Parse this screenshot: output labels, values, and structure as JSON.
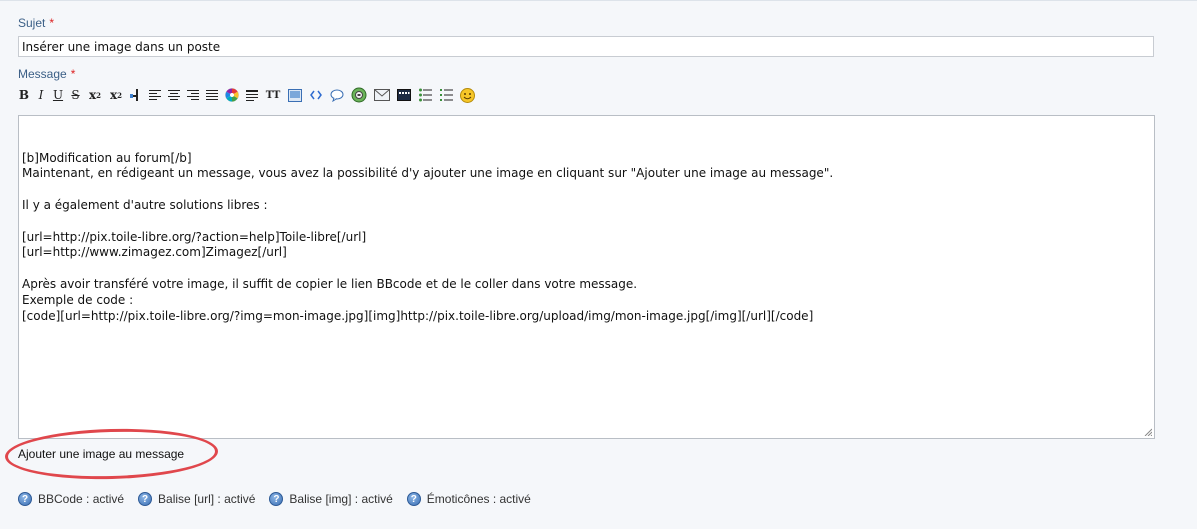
{
  "form": {
    "subject_label": "Sujet",
    "message_label": "Message",
    "required_mark": "*",
    "subject_value": "Insérer une image dans un poste",
    "message_lines": [
      "[b]Modification au forum[/b]",
      "Maintenant, en rédigeant un message, vous avez la possibilité d'y ajouter une image en cliquant sur \"Ajouter une image au message\".",
      "",
      "Il y a également d'autre solutions libres :",
      "",
      "[url=http://pix.toile-libre.org/?action=help]Toile-libre[/url]",
      "[url=http://www.zimagez.com]Zimagez[/url]",
      "",
      "Après avoir transféré votre image, il suffit de copier le lien BBcode et de le coller dans votre message.",
      "Exemple de code :",
      "[code][url=http://pix.toile-libre.org/?img=mon-image.jpg][img]http://pix.toile-libre.org/upload/img/mon-image.jpg[/img][/url][/code]"
    ],
    "add_image_link": "Ajouter une image au message"
  },
  "toolbar": {
    "bold": "B",
    "italic": "I",
    "underline": "U",
    "strike": "S",
    "superscript": "x",
    "superscript_mark": "2",
    "subscript": "x",
    "subscript_mark": "2",
    "font": "TT"
  },
  "status": {
    "help_glyph": "?",
    "items": [
      "BBCode : activé",
      "Balise [url] : activé",
      "Balise [img] : activé",
      "Émoticônes : activé"
    ]
  },
  "colors": {
    "label": "#3b5f86",
    "required": "#dd2222",
    "highlight": "#e0474c"
  }
}
